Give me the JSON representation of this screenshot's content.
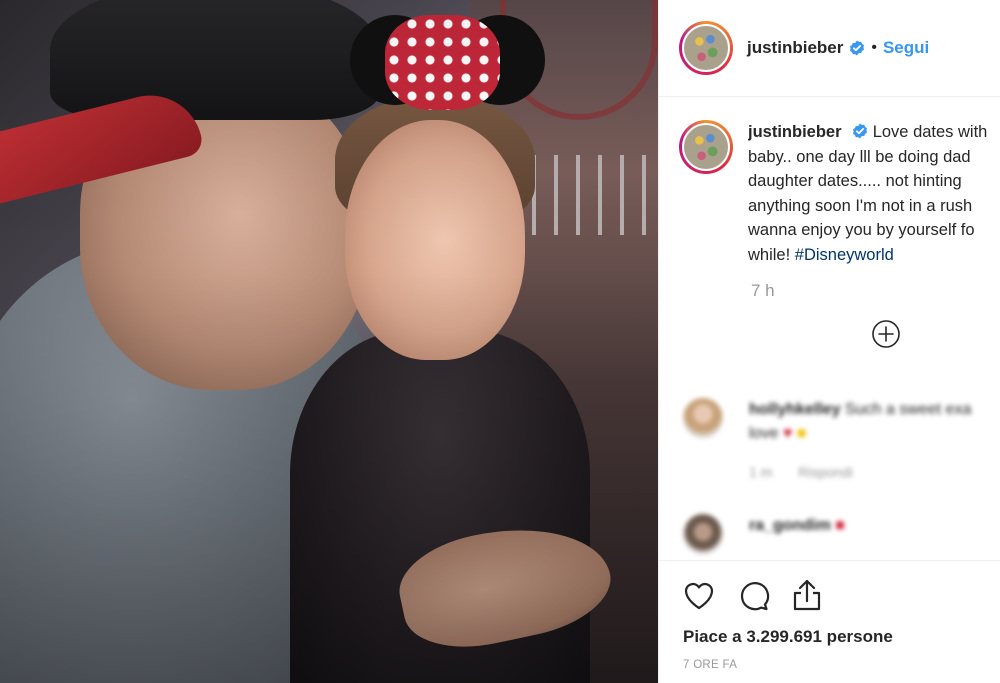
{
  "post": {
    "username": "justinbieber",
    "follow_label": "Segui",
    "separator": "•"
  },
  "caption": {
    "username": "justinbieber",
    "lines": [
      "Love dates with",
      "baby.. one day lll be doing dad",
      "daughter dates..... not hinting",
      "anything soon I'm not in a rush",
      "wanna enjoy you by yourself fo",
      "while! "
    ],
    "hashtag": "#Disneyworld",
    "time": "7 h"
  },
  "comments": [
    {
      "username": "hollyhkelley",
      "text": "Such a sweet exa",
      "line2": "love",
      "time": "1 m",
      "reply": "Rispondi"
    },
    {
      "username": "ra_gondim",
      "text": ""
    }
  ],
  "actions": {
    "likes_text": "Piace a 3.299.691 persone",
    "posted_ago": "7 ORE FA"
  },
  "icons": {
    "verified": "verified-badge-icon",
    "load_more": "plus-circle-icon",
    "like": "heart-icon",
    "comment": "comment-bubble-icon",
    "share": "share-icon"
  },
  "colors": {
    "link_blue": "#3897f0",
    "verified_blue": "#3897f0",
    "text": "#262626",
    "muted": "#999999",
    "hashtag": "#003569"
  }
}
